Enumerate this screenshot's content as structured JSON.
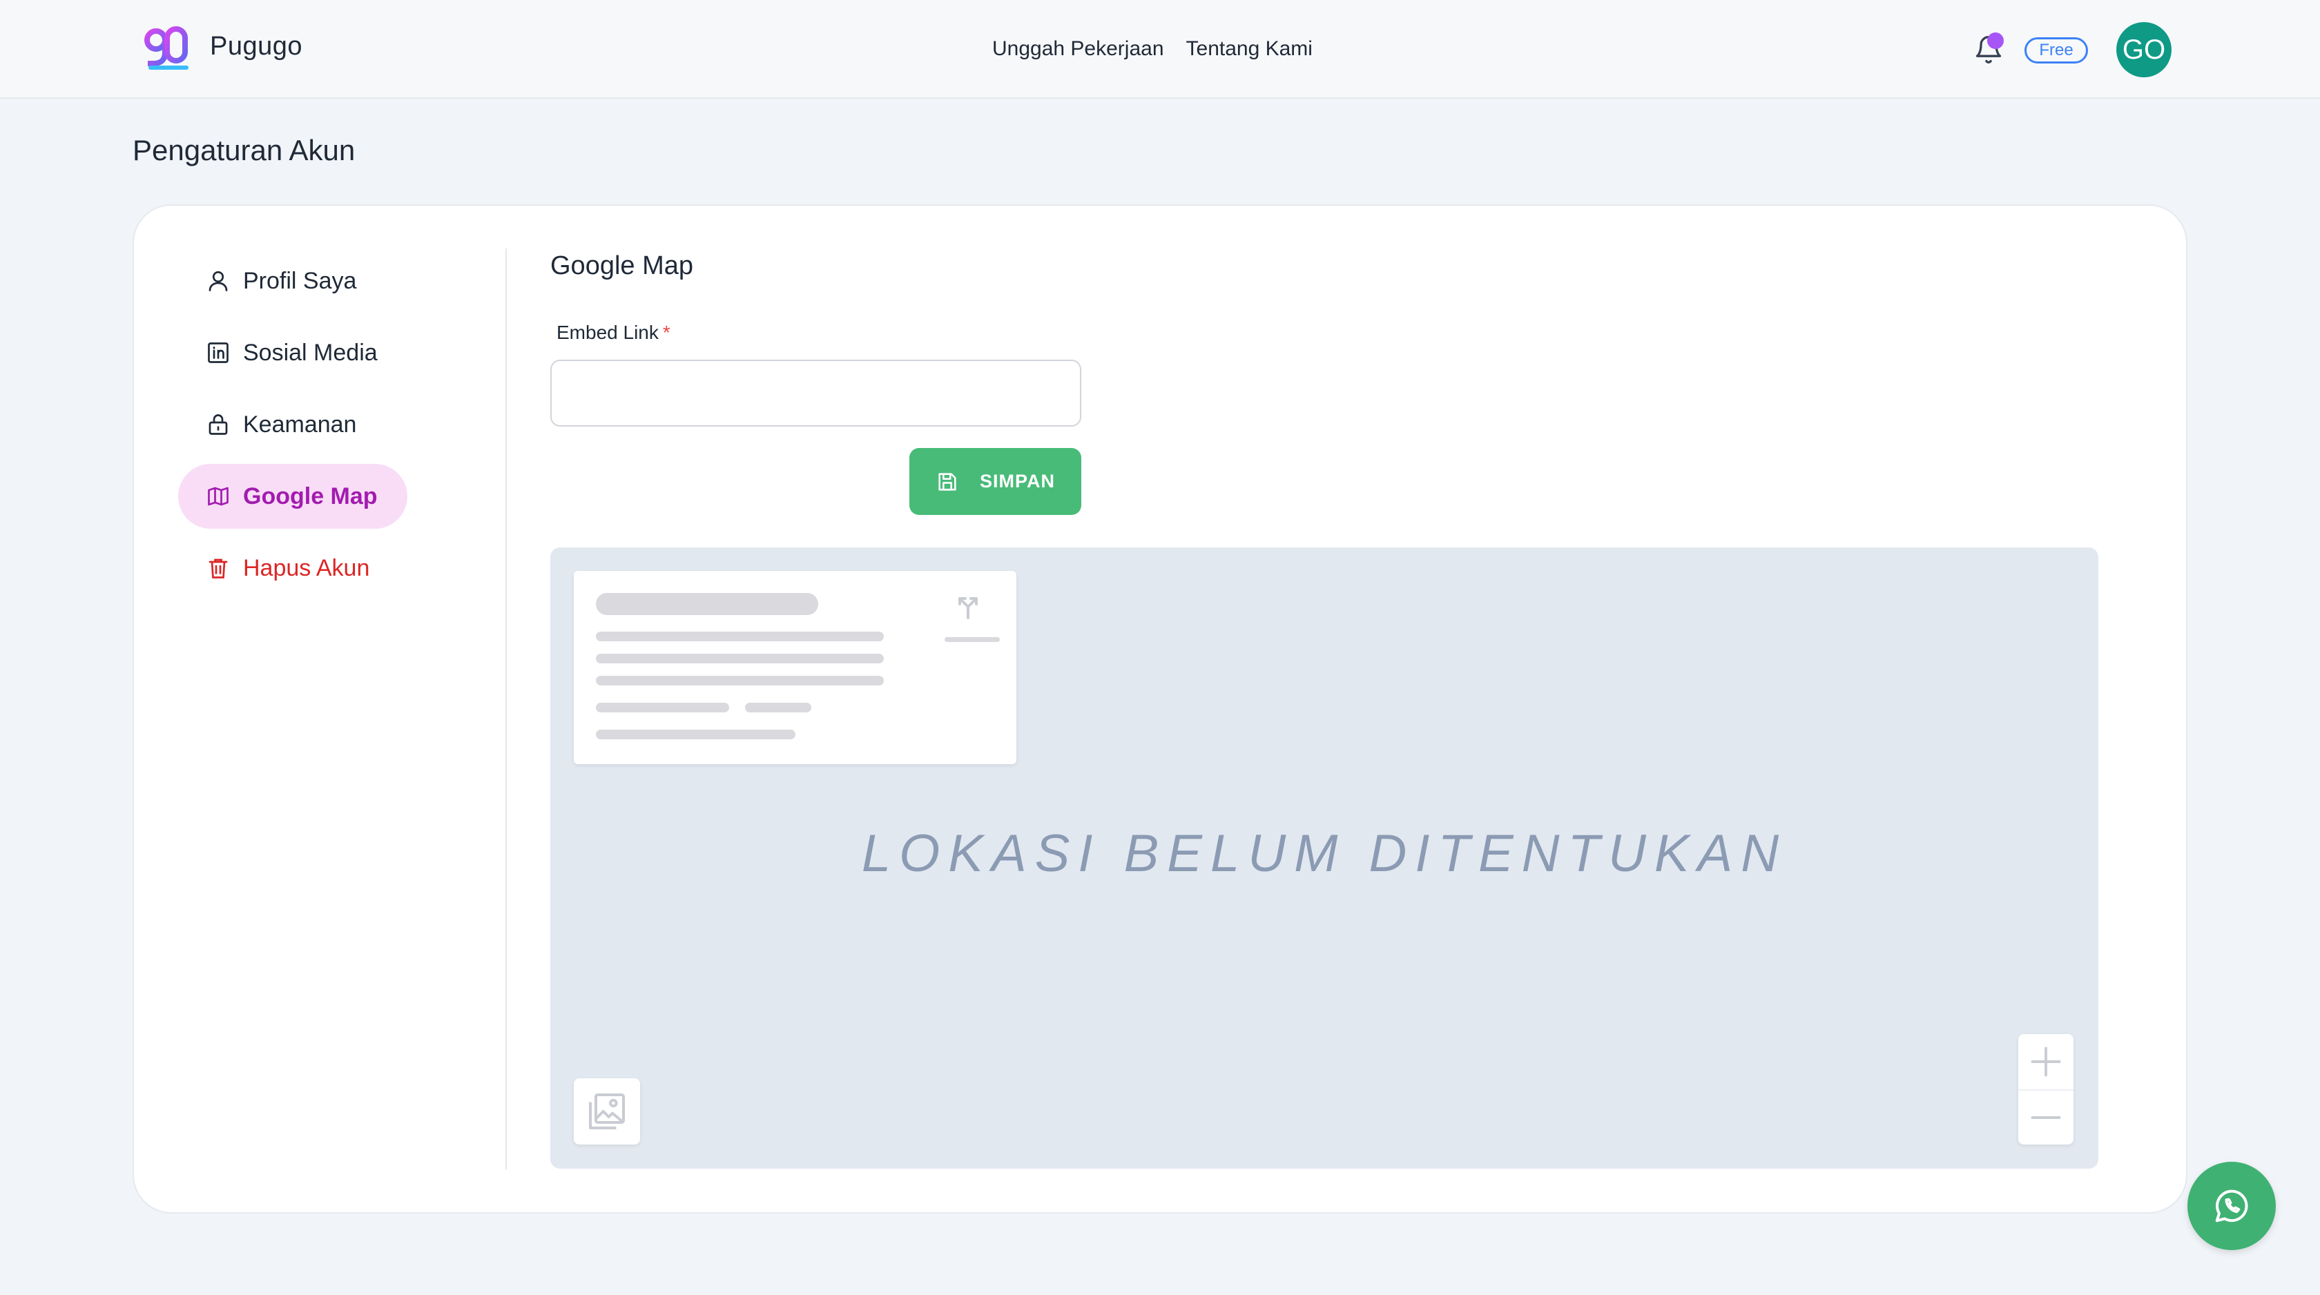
{
  "app": {
    "brand": "Pugugo"
  },
  "nav": {
    "items": [
      "Unggah Pekerjaan",
      "Tentang Kami"
    ]
  },
  "header": {
    "plan_badge": "Free",
    "avatar_initials": "GO",
    "notification_icon": "bell-icon",
    "notification_dot_color": "#a855f7"
  },
  "page": {
    "title": "Pengaturan Akun"
  },
  "sidebar": {
    "items": [
      {
        "label": "Profil Saya",
        "icon": "user-icon"
      },
      {
        "label": "Sosial Media",
        "icon": "linkedin-icon"
      },
      {
        "label": "Keamanan",
        "icon": "lock-icon"
      },
      {
        "label": "Google Map",
        "icon": "map-icon",
        "active": true
      },
      {
        "label": "Hapus Akun",
        "icon": "trash-icon",
        "danger": true
      }
    ]
  },
  "form": {
    "section_title": "Google Map",
    "embed_label": "Embed Link",
    "required_mark": "*",
    "embed_value": "",
    "save_label": "SIMPAN"
  },
  "map": {
    "placeholder_text": "LOKASI BELUM DITENTUKAN"
  },
  "colors": {
    "accent_green": "#48bb78",
    "active_bg": "#f9ddf7",
    "active_text": "#a21caf",
    "danger": "#dc2626",
    "avatar_bg": "#0f9a86",
    "badge_blue": "#3b82f6"
  }
}
